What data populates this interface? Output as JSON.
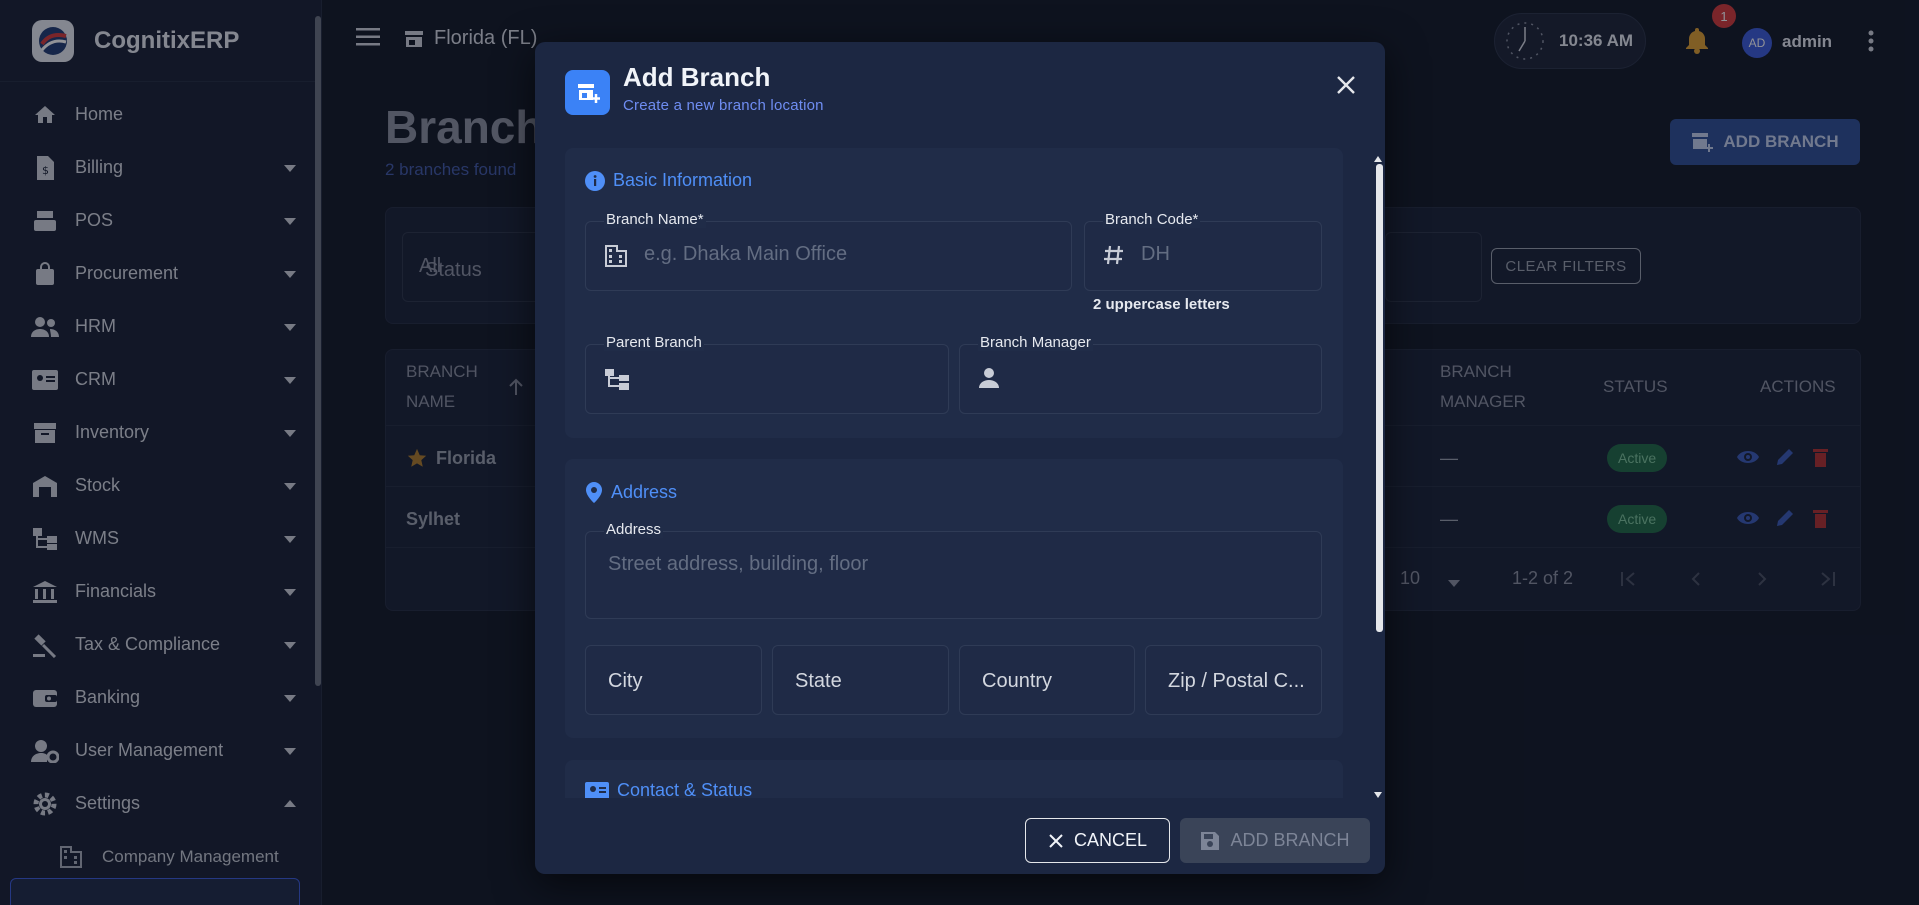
{
  "app": {
    "name": "CognitixERP"
  },
  "sidebar": {
    "items": [
      {
        "label": "Home",
        "icon": "home-icon"
      },
      {
        "label": "Billing",
        "icon": "billing-icon"
      },
      {
        "label": "POS",
        "icon": "pos-icon"
      },
      {
        "label": "Procurement",
        "icon": "procurement-icon"
      },
      {
        "label": "HRM",
        "icon": "hrm-icon"
      },
      {
        "label": "CRM",
        "icon": "crm-icon"
      },
      {
        "label": "Inventory",
        "icon": "inventory-icon"
      },
      {
        "label": "Stock",
        "icon": "stock-icon"
      },
      {
        "label": "WMS",
        "icon": "wms-icon"
      },
      {
        "label": "Financials",
        "icon": "financials-icon"
      },
      {
        "label": "Tax & Compliance",
        "icon": "tax-icon"
      },
      {
        "label": "Banking",
        "icon": "banking-icon"
      },
      {
        "label": "User Management",
        "icon": "user-management-icon"
      },
      {
        "label": "Settings",
        "icon": "gear-icon"
      }
    ],
    "sub_items": [
      {
        "label": "Company Management",
        "icon": "building-icon"
      }
    ]
  },
  "topbar": {
    "branch": "Florida (FL)",
    "time": "10:36 AM",
    "notifications": "1",
    "avatar_initials": "AD",
    "username": "admin"
  },
  "page": {
    "title": "Branch",
    "subtitle": "2 branches found",
    "add_button": "ADD BRANCH",
    "status_filter_value": "All",
    "status_filter_label": "Status",
    "clear_filters": "CLEAR FILTERS",
    "columns": [
      "BRANCH NAME",
      "BRANCH MANAGER",
      "STATUS",
      "ACTIONS"
    ],
    "rows": [
      {
        "name": "Florida",
        "manager": "—",
        "status": "Active",
        "default": true
      },
      {
        "name": "Sylhet",
        "manager": "—",
        "status": "Active",
        "default": false
      }
    ],
    "rows_per_page": "10",
    "pagination": "1-2 of 2"
  },
  "modal": {
    "title": "Add Branch",
    "subtitle": "Create a new branch location",
    "sections": {
      "basic": {
        "title": "Basic Information",
        "branch_name_label": "Branch Name*",
        "branch_name_placeholder": "e.g. Dhaka Main Office",
        "branch_code_label": "Branch Code*",
        "branch_code_placeholder": "DH",
        "branch_code_helper": "2 uppercase letters",
        "parent_branch_label": "Parent Branch",
        "branch_manager_label": "Branch Manager"
      },
      "address": {
        "title": "Address",
        "address_label": "Address",
        "address_placeholder": "Street address, building, floor",
        "city": "City",
        "state": "State",
        "country": "Country",
        "zip": "Zip / Postal C..."
      },
      "contact": {
        "title": "Contact & Status"
      }
    },
    "cancel": "CANCEL",
    "submit": "ADD BRANCH"
  },
  "colors": {
    "accent": "#3b82f6",
    "active_badge": "#1f6b45",
    "notification": "#d63a3a"
  }
}
